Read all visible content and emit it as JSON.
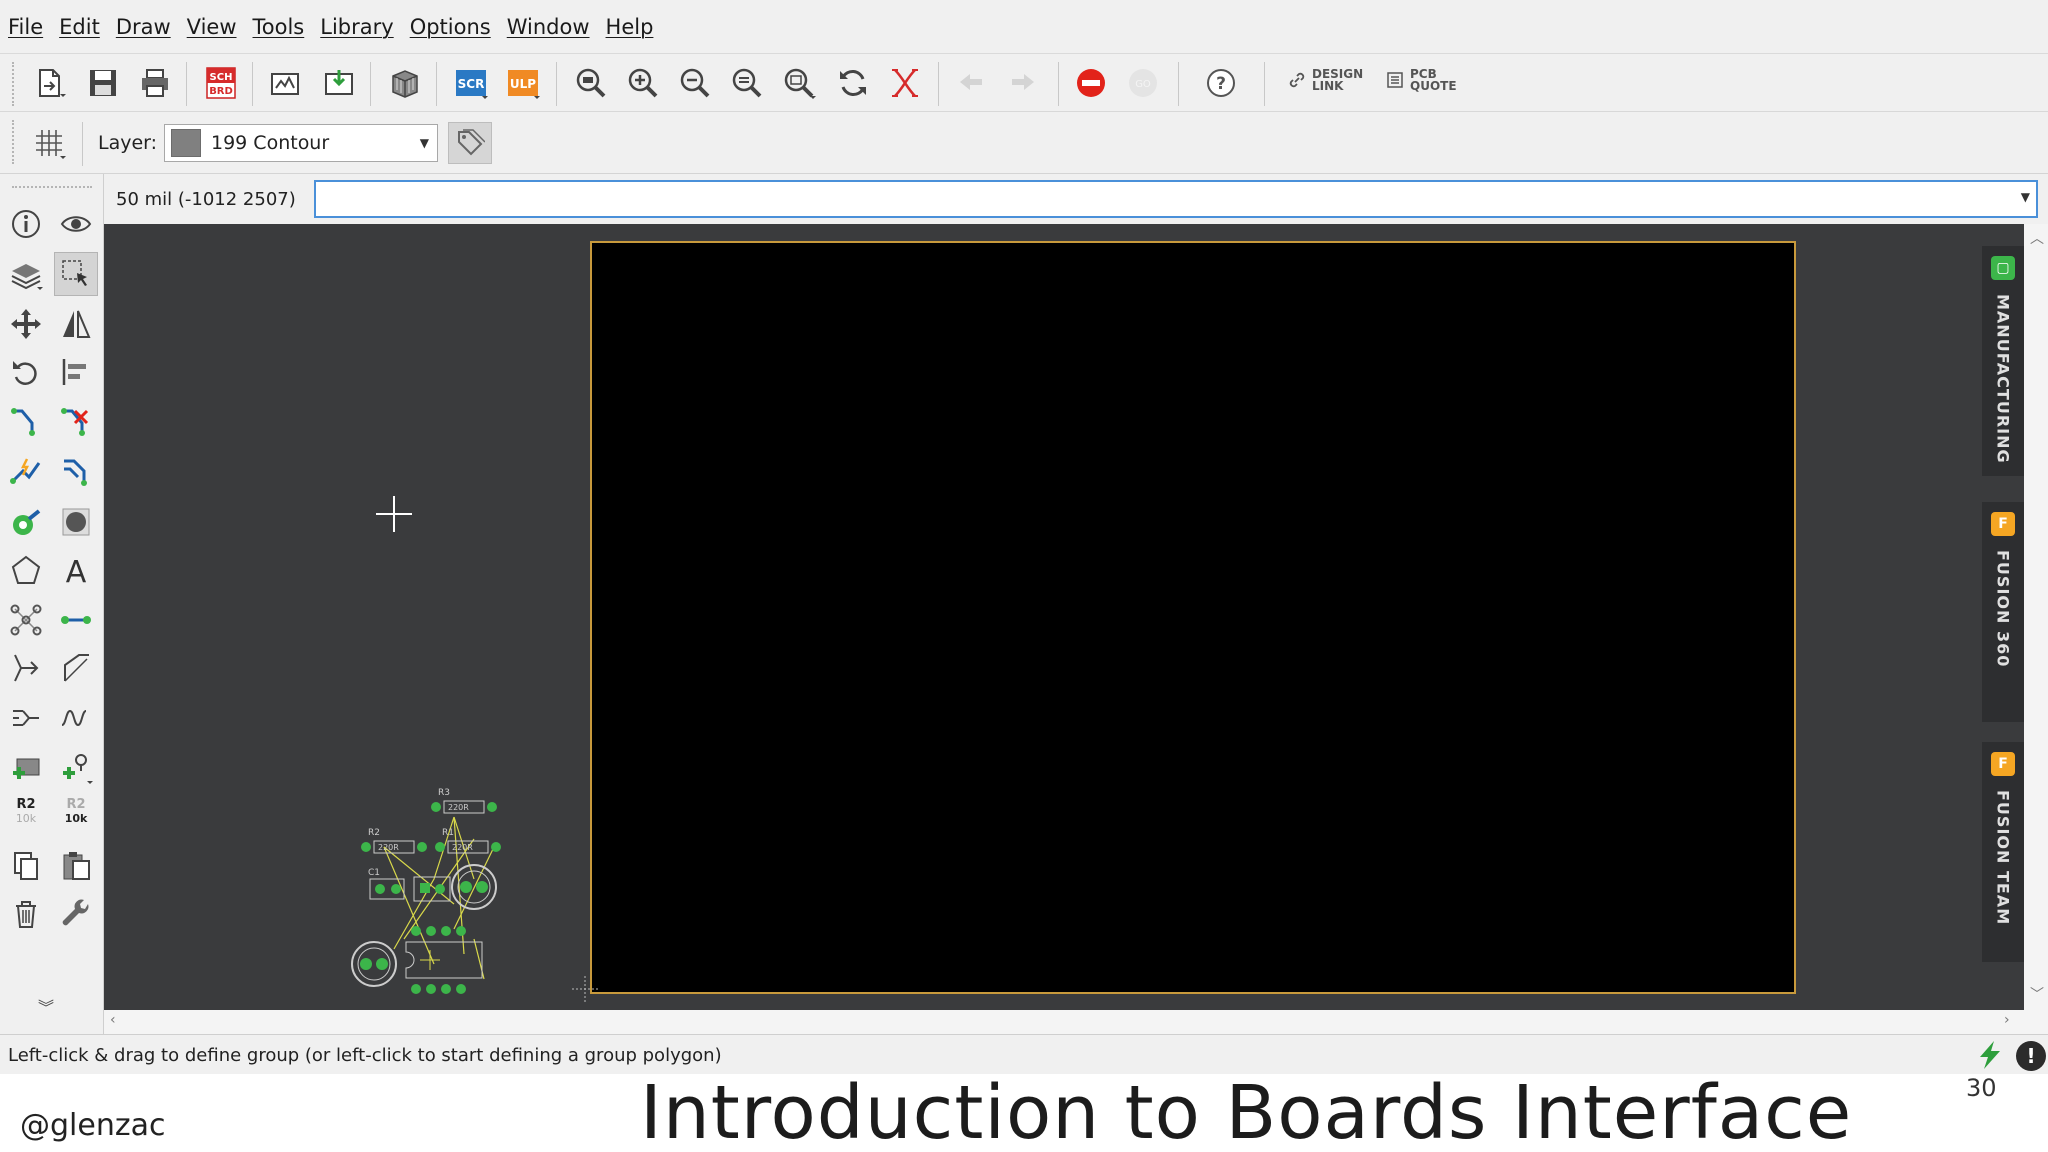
{
  "menu": [
    "File",
    "Edit",
    "Draw",
    "View",
    "Tools",
    "Library",
    "Options",
    "Window",
    "Help"
  ],
  "toolbar": {
    "sch_label_top": "SCH",
    "sch_label_bottom": "BRD",
    "scr_label": "SCR",
    "ulp_label": "ULP",
    "design_link_line1": "DESIGN",
    "design_link_line2": "LINK",
    "pcb_quote_line1": "PCB",
    "pcb_quote_line2": "QUOTE",
    "help_glyph": "?"
  },
  "layer": {
    "label": "Layer:",
    "value": "199 Contour",
    "swatch_color": "#808080"
  },
  "command": {
    "coordinate": "50 mil (-1012 2507)",
    "input_value": "",
    "input_placeholder": ""
  },
  "palette": {
    "text_tool_glyph": "A",
    "name_tool": {
      "top": "R2",
      "bottom": "10k"
    },
    "value_tool": {
      "top": "R2",
      "bottom": "10k"
    }
  },
  "right_panel": {
    "tabs": [
      {
        "label": "MANUFACTURING",
        "icon_color": "#3cb54a",
        "icon_glyph": "▢"
      },
      {
        "label": "FUSION 360",
        "icon_color": "#f5a623",
        "icon_glyph": "F"
      },
      {
        "label": "FUSION TEAM",
        "icon_color": "#f5a623",
        "icon_glyph": "F"
      }
    ]
  },
  "status": {
    "message": "Left-click & drag to define group (or left-click to start defining a group polygon)",
    "warning_glyph": "!"
  },
  "parts": {
    "r3": "R3",
    "r2": "R2",
    "r1": "R1",
    "c1": "C1",
    "v220": "220R"
  },
  "slide": {
    "handle": "@glenzac",
    "title": "Introduction to Boards Interface",
    "number": "30"
  },
  "colors": {
    "board_outline": "#c89a3c",
    "canvas_bg": "#3a3b3d",
    "pad_green": "#3cb54a",
    "stop_red": "#e2231a",
    "scr_blue": "#2a79c4",
    "ulp_orange": "#f08a24"
  }
}
